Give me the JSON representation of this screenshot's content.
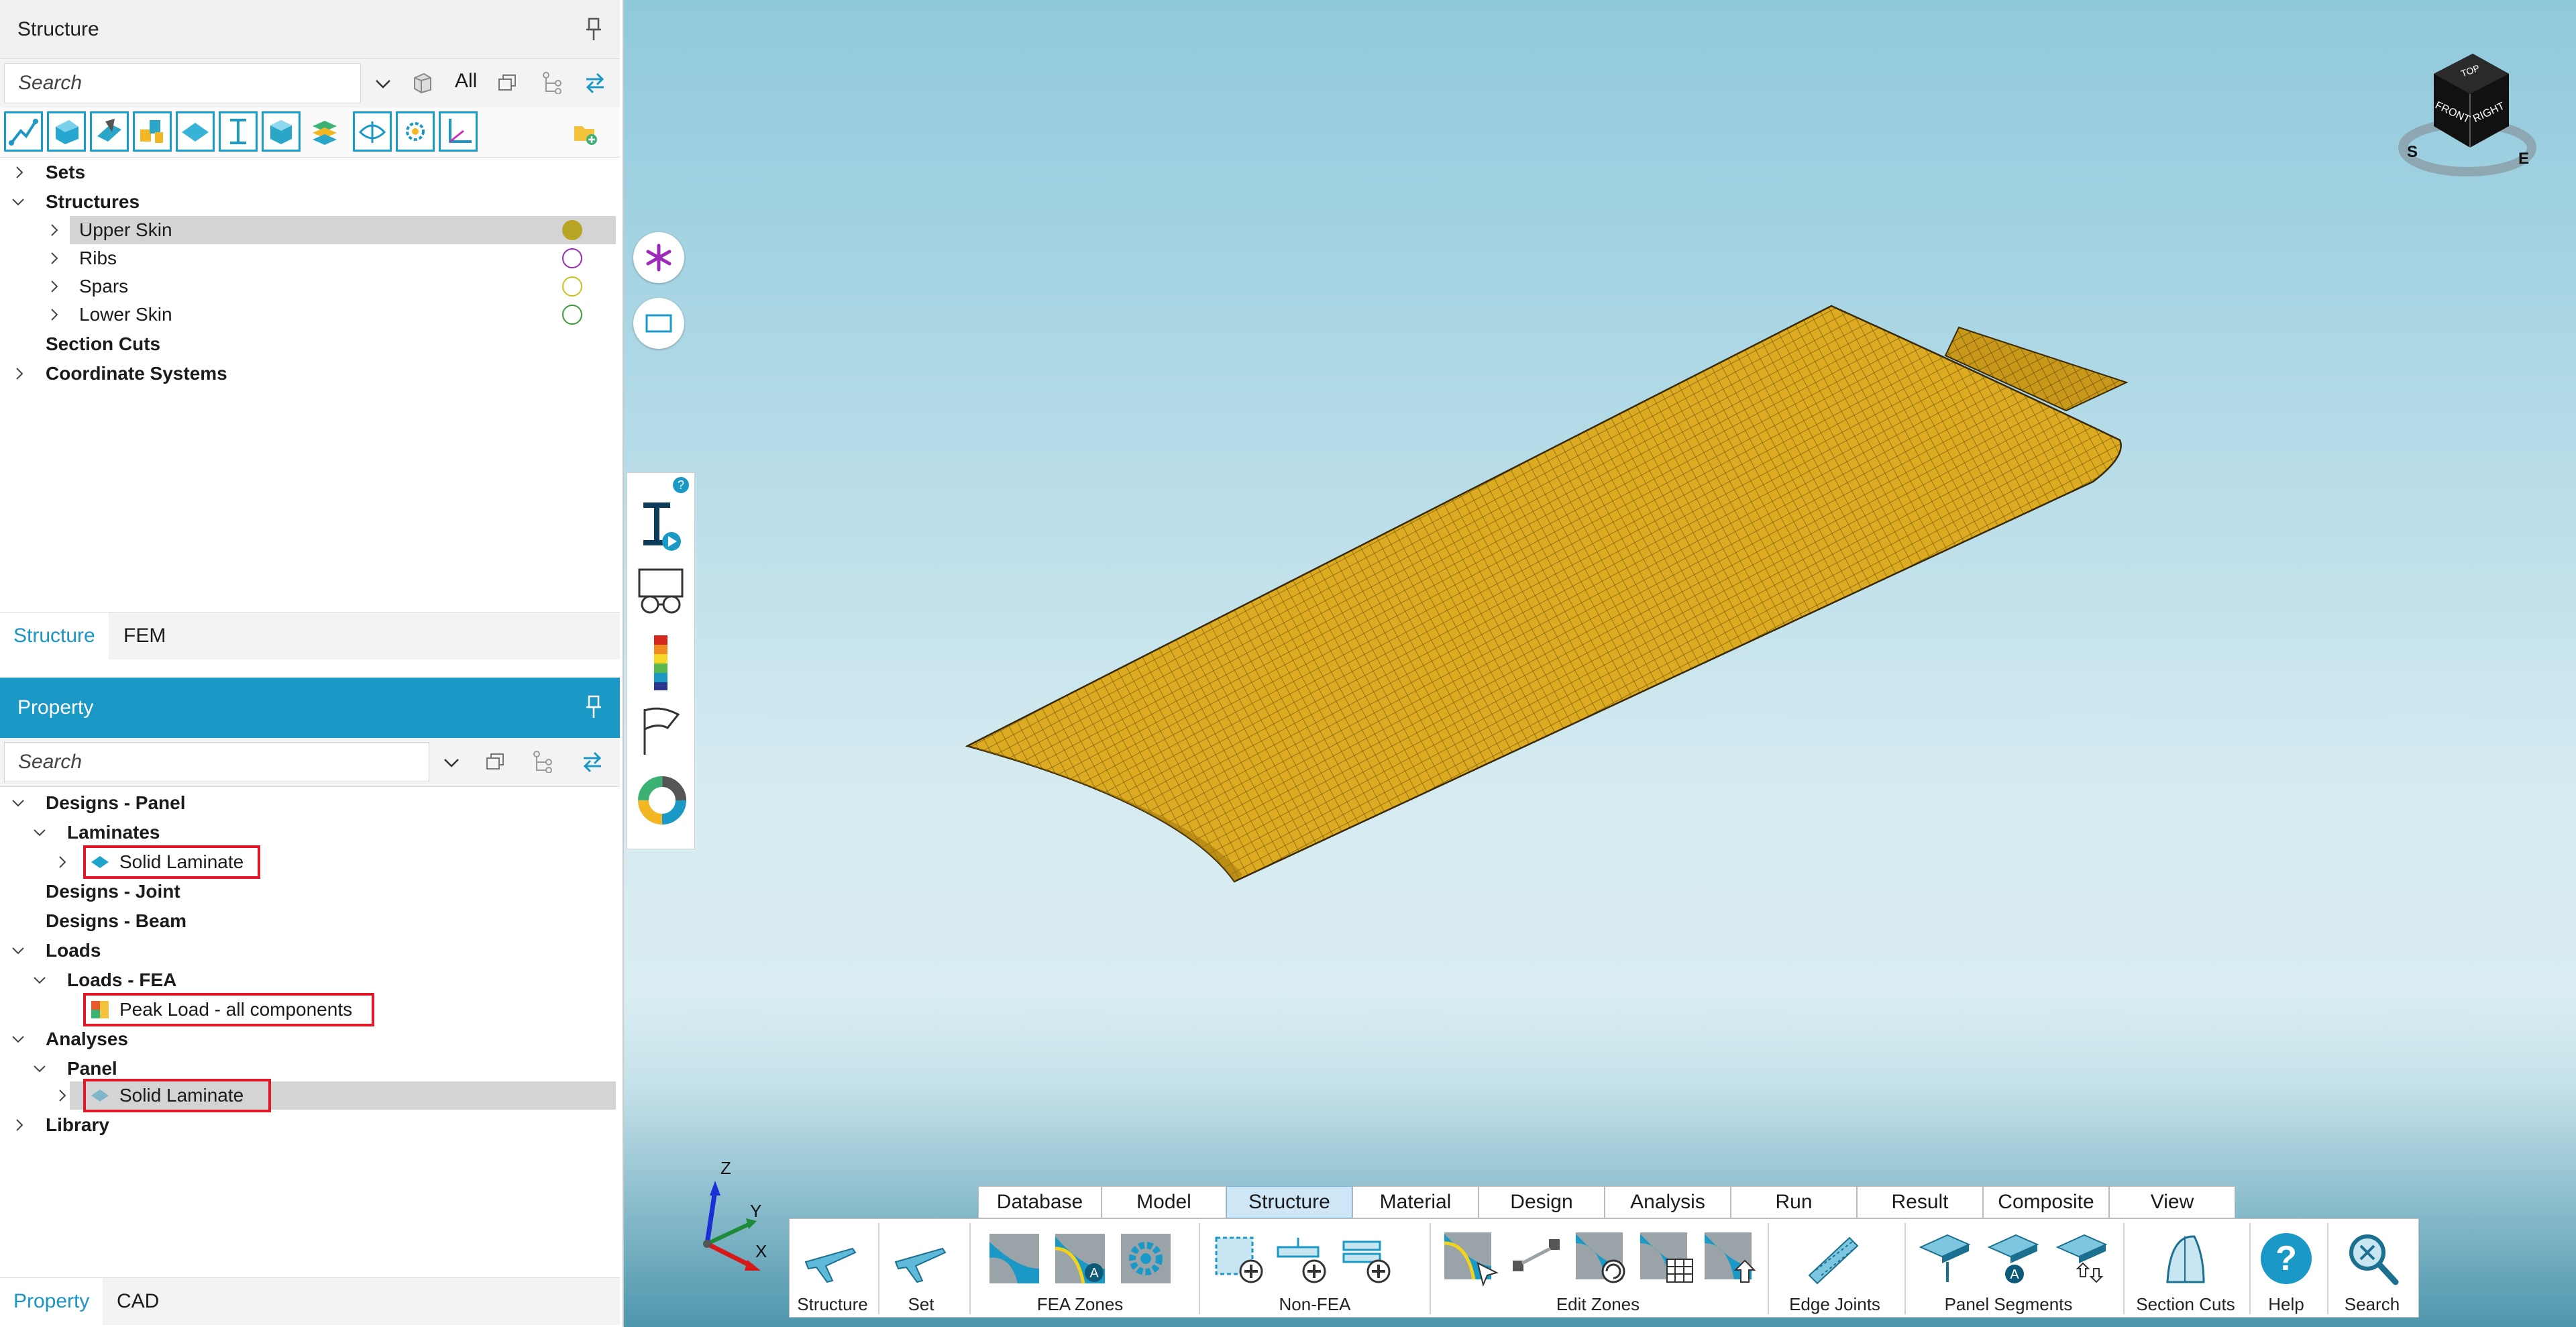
{
  "structure_panel": {
    "title": "Structure",
    "search_placeholder": "Search",
    "filter_label": "All",
    "tree": [
      {
        "label": "Sets",
        "bold": true
      },
      {
        "label": "Structures",
        "bold": true
      },
      {
        "label": "Upper Skin",
        "color": "#b8a526",
        "filled": true
      },
      {
        "label": "Ribs",
        "color": "#9b2bb8",
        "filled": false
      },
      {
        "label": "Spars",
        "color": "#c9c21e",
        "filled": false
      },
      {
        "label": "Lower Skin",
        "color": "#3d9b3a",
        "filled": false
      },
      {
        "label": "Section Cuts",
        "bold": true
      },
      {
        "label": "Coordinate Systems",
        "bold": true
      }
    ],
    "tabs": [
      "Structure",
      "FEM"
    ]
  },
  "property_panel": {
    "title": "Property",
    "search_placeholder": "Search",
    "tree": [
      {
        "label": "Designs - Panel"
      },
      {
        "label": "Laminates"
      },
      {
        "label": "Solid Laminate"
      },
      {
        "label": "Designs - Joint"
      },
      {
        "label": "Designs - Beam"
      },
      {
        "label": "Loads"
      },
      {
        "label": "Loads - FEA"
      },
      {
        "label": "Peak Load - all components"
      },
      {
        "label": "Analyses"
      },
      {
        "label": "Panel"
      },
      {
        "label": "Solid Laminate"
      },
      {
        "label": "Library"
      }
    ],
    "tabs": [
      "Property",
      "CAD"
    ]
  },
  "viewcube": {
    "top": "TOP",
    "front": "FRONT",
    "right": "RIGHT",
    "compass_s": "S",
    "compass_e": "E"
  },
  "axes": {
    "x": "X",
    "y": "Y",
    "z": "Z"
  },
  "side_toolbar": {
    "help": "?"
  },
  "ribbon": {
    "tabs": [
      "Database",
      "Model",
      "Structure",
      "Material",
      "Design",
      "Analysis",
      "Run",
      "Result",
      "Composite",
      "View"
    ],
    "active_tab": "Structure",
    "groups": [
      "Structure",
      "Set",
      "FEA Zones",
      "Non-FEA",
      "Edit Zones",
      "Edge Joints",
      "Panel Segments",
      "Section Cuts",
      "Help",
      "Search"
    ]
  },
  "colors": {
    "accent": "#1b99c6",
    "mesh": "#d9a820",
    "highlight": "#e0192a"
  }
}
